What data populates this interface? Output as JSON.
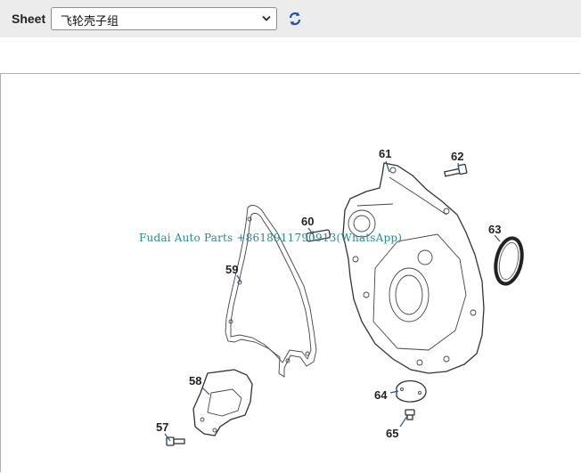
{
  "toolbar": {
    "sheet_label": "Sheet",
    "sheet_selected": "飞轮壳子组",
    "refresh_icon": "refresh-icon"
  },
  "diagram": {
    "callouts": [
      "57",
      "58",
      "59",
      "60",
      "61",
      "62",
      "63",
      "64",
      "65"
    ],
    "watermark": "Fudai Auto Parts +8618911790913(WhatsApp)"
  }
}
